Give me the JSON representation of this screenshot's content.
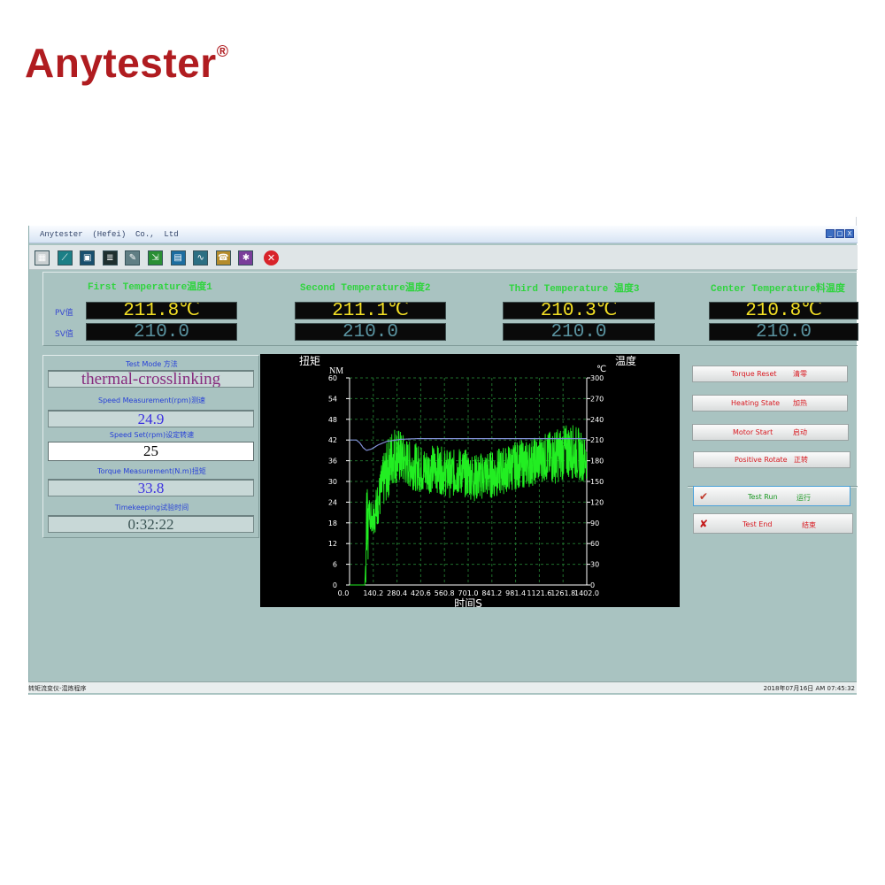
{
  "brand": {
    "logo_text": "Anytester",
    "registered": "®"
  },
  "window": {
    "title": "Anytester  (Hefei)  Co.,  Ltd",
    "controls": [
      "_",
      "□",
      "X"
    ]
  },
  "toolbar": {
    "icons": [
      {
        "name": "toolbar-grid-icon",
        "glyph": "▦",
        "bg": "#c9cfd1"
      },
      {
        "name": "toolbar-chart-line-icon",
        "glyph": "⟋",
        "bg": "#1b7f86"
      },
      {
        "name": "toolbar-save-icon",
        "glyph": "▣",
        "bg": "#184f6e"
      },
      {
        "name": "toolbar-table-icon",
        "glyph": "≣",
        "bg": "#1f2f2f"
      },
      {
        "name": "toolbar-settings-icon",
        "glyph": "✎",
        "bg": "#607e84"
      },
      {
        "name": "toolbar-export-icon",
        "glyph": "⇲",
        "bg": "#2a8f34"
      },
      {
        "name": "toolbar-document-icon",
        "glyph": "▤",
        "bg": "#1d6da0"
      },
      {
        "name": "toolbar-curve-icon",
        "glyph": "∿",
        "bg": "#2c6f83"
      },
      {
        "name": "toolbar-phone-icon",
        "glyph": "☎",
        "bg": "#b58c2c"
      },
      {
        "name": "toolbar-palette-icon",
        "glyph": "✱",
        "bg": "#7a3d9a"
      }
    ],
    "close_glyph": "✕"
  },
  "temperatures": [
    {
      "title": "First Temperature温度1",
      "pv": "211.8℃",
      "sv": "210.0"
    },
    {
      "title": "Second Temperature温度2",
      "pv": "211.1℃",
      "sv": "210.0"
    },
    {
      "title": "Third Temperature 温度3",
      "pv": "210.3℃",
      "sv": "210.0"
    },
    {
      "title": "Center Temperature料温度",
      "pv": "210.8℃",
      "sv": "210.0"
    }
  ],
  "labels": {
    "pv": "PV值",
    "sv": "SV值"
  },
  "left": {
    "mode_label": "Test Mode    方法",
    "mode_value": "thermal-crosslinking",
    "speed_meas_label": "Speed Measurement(rpm)测速",
    "speed_meas_value": "24.9",
    "speed_set_label": "Speed Set(rpm)设定转速",
    "speed_set_value": "25",
    "torque_label": "Torque Measurement(N.m)扭矩",
    "torque_value": "33.8",
    "time_label": "Timekeeping试验时间",
    "time_value": "0:32:22"
  },
  "buttons": {
    "torque_reset": {
      "en": "Torque Reset",
      "cn": "清零"
    },
    "heating_state": {
      "en": "Heating State",
      "cn": "加热"
    },
    "motor_start": {
      "en": "Motor Start",
      "cn": "启动"
    },
    "positive_rotate": {
      "en": "Positive Rotate",
      "cn": "正转"
    },
    "test_run": {
      "en": "Test Run",
      "cn": "运行",
      "icon": "✔"
    },
    "test_end": {
      "en": "Test End",
      "cn": "结束",
      "icon": "✘"
    }
  },
  "status": {
    "left": "转矩流变仪-混炼程序",
    "right": "2018年07月16日 AM 07:45:32"
  },
  "chart_data": {
    "type": "line",
    "ylabel_cn": "扭矩",
    "yunit": "NM",
    "y2label_cn": "温度",
    "y2unit": "℃",
    "xlabel": "时间S",
    "xlim": [
      0,
      1402
    ],
    "ylim": [
      0,
      60
    ],
    "y2lim": [
      0,
      300
    ],
    "x_ticks": [
      "0.0",
      "140.2",
      "280.4",
      "420.6",
      "560.8",
      "701.0",
      "841.2",
      "981.4",
      "1121.6",
      "1261.8",
      "1402.0"
    ],
    "y_ticks": [
      "0",
      "6",
      "12",
      "18",
      "24",
      "30",
      "36",
      "42",
      "48",
      "54",
      "60"
    ],
    "y2_ticks": [
      "0",
      "30",
      "60",
      "90",
      "120",
      "150",
      "180",
      "210",
      "240",
      "270",
      "300"
    ],
    "grid": true,
    "series": [
      {
        "color": "#22ee22",
        "axis": "left",
        "x": [
          0,
          40,
          60,
          75,
          90,
          110,
          130,
          150,
          175,
          200,
          230,
          260,
          300,
          350,
          400,
          450,
          500,
          550,
          600,
          650,
          700,
          750,
          800,
          850,
          900,
          950,
          1000,
          1050,
          1100,
          1150,
          1200,
          1250,
          1300,
          1350,
          1400
        ],
        "y": [
          0,
          0,
          0,
          0,
          0,
          22,
          20,
          21,
          25,
          30,
          34,
          38,
          37,
          35,
          34,
          33,
          34,
          33,
          32,
          33,
          32,
          31,
          32,
          32,
          33,
          34,
          35,
          35,
          36,
          37,
          37,
          38,
          39,
          38,
          36
        ],
        "noise": [
          0,
          0,
          0,
          0,
          0,
          4,
          5,
          6,
          7,
          8,
          9,
          9,
          8,
          7,
          7,
          7,
          7,
          7,
          7,
          7,
          7,
          7,
          7,
          7,
          7,
          7,
          7,
          7,
          7,
          7,
          8,
          8,
          8,
          8,
          6
        ]
      },
      {
        "color": "#8290d6",
        "axis": "right",
        "x": [
          0,
          40,
          60,
          80,
          100,
          130,
          170,
          220,
          300,
          400,
          500,
          600,
          700,
          800,
          900,
          1000,
          1100,
          1200,
          1300,
          1402
        ],
        "y": [
          210,
          210,
          206,
          199,
          195,
          197,
          203,
          208,
          211,
          212,
          212,
          212,
          212,
          212,
          212,
          212,
          212,
          212,
          212,
          212
        ]
      }
    ]
  }
}
